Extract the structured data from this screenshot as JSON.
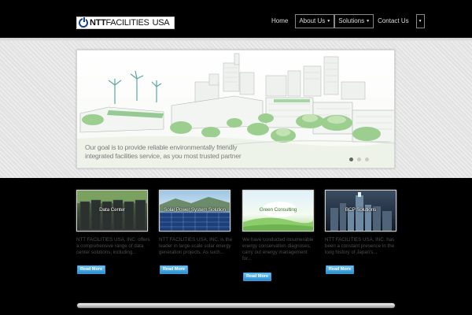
{
  "header": {
    "logo": {
      "brand": "NTT",
      "name": "FACILITIES",
      "suffix": "USA"
    },
    "nav": [
      {
        "label": "Home"
      },
      {
        "label": "About Us"
      },
      {
        "label": "Solutions"
      },
      {
        "label": "Contact Us"
      }
    ]
  },
  "slider": {
    "caption_line1": "Our goal is to provide reliable environmentally friendly",
    "caption_line2": "integrated facilities service, as you most trusted partner",
    "active_slide": 1,
    "slide_count": 3
  },
  "services": [
    {
      "title": "Data Center",
      "description": "NTT FACILITIES USA, INC. offers a comprehensive range of data center solutions, including...",
      "button": "Read More"
    },
    {
      "title": "Solar Power System Solution",
      "description": "NTT FACILITIES USA, INC. is the leader in large-scale solar energy generation projects. As such...",
      "button": "Read More"
    },
    {
      "title": "Green Consulting",
      "description": "We have conducted innumerable energy conservation diagnoses, carry out energy management for...",
      "button": "Read More"
    },
    {
      "title": "BCP Solutions",
      "description": "NTT FACILITIES USA, INC. has been a constant presence in the long history of Japan's...",
      "button": "Read More"
    }
  ],
  "colors": {
    "background": "#000000",
    "button_blue": "#2c8fd0",
    "logo_blue": "#1a3f8f"
  }
}
